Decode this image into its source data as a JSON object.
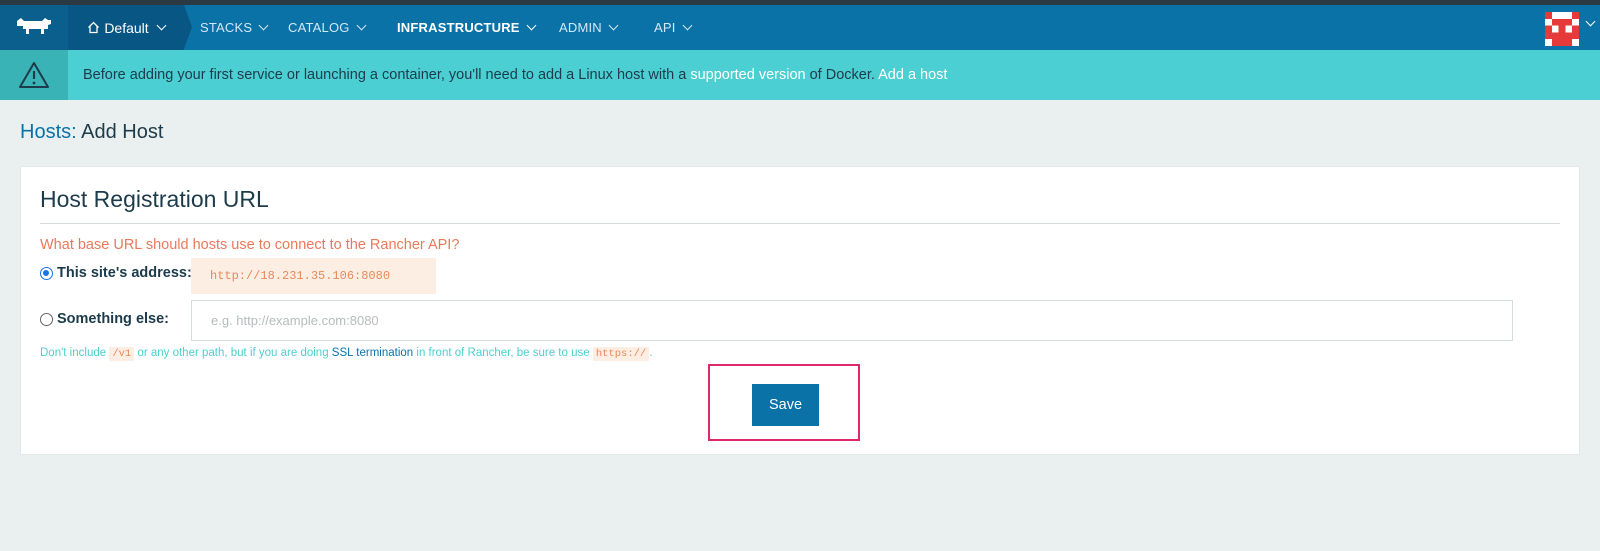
{
  "nav": {
    "environment": "Default",
    "items": [
      {
        "label": "STACKS",
        "active": false
      },
      {
        "label": "CATALOG",
        "active": false
      },
      {
        "label": "INFRASTRUCTURE",
        "active": true
      },
      {
        "label": "ADMIN",
        "active": false
      },
      {
        "label": "API",
        "active": false
      }
    ],
    "logo_icon": "rancher-cow-icon",
    "avatar_icon": "user-avatar-identicon"
  },
  "banner": {
    "icon": "warning-triangle-icon",
    "text_before": "Before adding your first service or launching a container, you'll need to add a Linux host with a ",
    "link_supported": "supported version",
    "text_after": " of Docker. ",
    "link_add_host": "Add a host"
  },
  "page": {
    "crumb": "Hosts:",
    "title": "Add Host"
  },
  "card": {
    "title": "Host Registration URL",
    "question": "What base URL should hosts use to connect to the Rancher API?",
    "option_site": {
      "label": "This site's address:",
      "value": "http://18.231.35.106:8080",
      "selected": true
    },
    "option_else": {
      "label": "Something else:",
      "placeholder": "e.g. http://example.com:8080",
      "selected": false
    },
    "help": {
      "part1": "Don't include ",
      "code1": "/v1",
      "part2": " or any other path, but if you are doing ",
      "link": "SSL termination",
      "part3": " in front of Rancher, be sure to use ",
      "code2": "https://",
      "part4": "."
    },
    "save_label": "Save"
  },
  "colors": {
    "nav_bg": "#0b72a8",
    "banner_bg": "#4ccfd2",
    "accent_orange": "#e9795a",
    "highlight": "#e0286e"
  }
}
